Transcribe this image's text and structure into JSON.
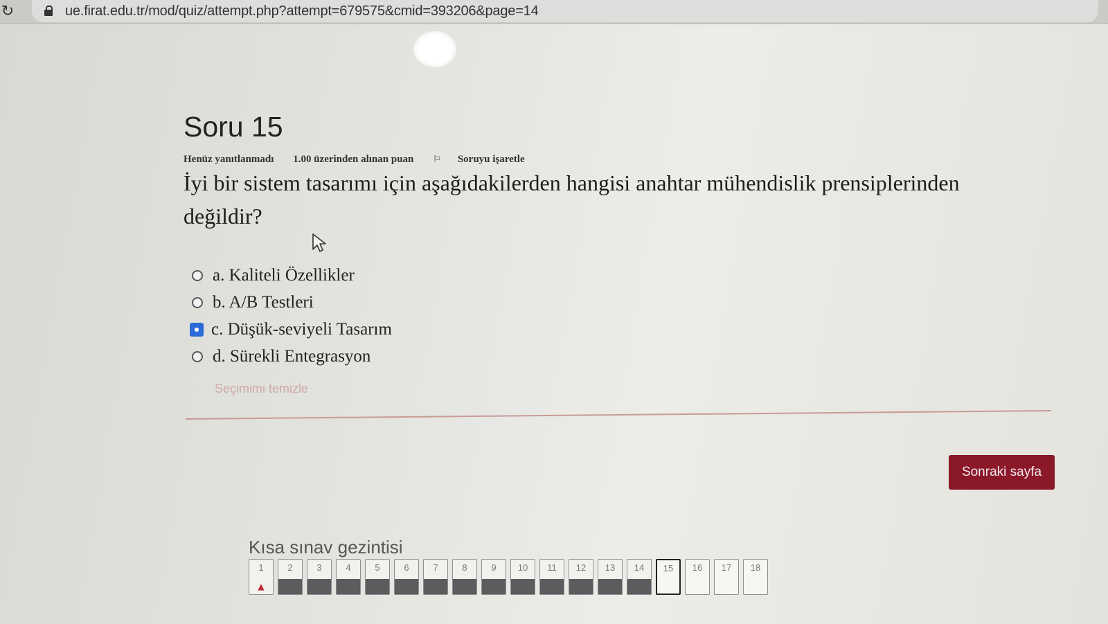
{
  "browser": {
    "url": "ue.firat.edu.tr/mod/quiz/attempt.php?attempt=679575&cmid=393206&page=14"
  },
  "question": {
    "title": "Soru 15",
    "status": "Henüz yanıtlanmadı",
    "points": "1.00 üzerinden alınan puan",
    "flag_label": "Soruyu işaretle",
    "text": "İyi bir sistem tasarımı için aşağıdakilerden hangisi anahtar mühendislik prensiplerinden değildir?",
    "answers": [
      {
        "label": "a. Kaliteli Özellikler",
        "selected": false
      },
      {
        "label": "b. A/B Testleri",
        "selected": false
      },
      {
        "label": "c. Düşük-seviyeli Tasarım",
        "selected": true
      },
      {
        "label": "d. Sürekli Entegrasyon",
        "selected": false
      }
    ],
    "clear_choice": "Seçimimi temizle"
  },
  "next_button": "Sonraki sayfa",
  "navigation": {
    "title": "Kısa sınav gezintisi",
    "items": [
      {
        "label": "1",
        "state": "flagged"
      },
      {
        "label": "2",
        "state": "answered"
      },
      {
        "label": "3",
        "state": "answered"
      },
      {
        "label": "4",
        "state": "answered"
      },
      {
        "label": "5",
        "state": "answered"
      },
      {
        "label": "6",
        "state": "answered"
      },
      {
        "label": "7",
        "state": "answered"
      },
      {
        "label": "8",
        "state": "answered"
      },
      {
        "label": "9",
        "state": "answered"
      },
      {
        "label": "10",
        "state": "answered"
      },
      {
        "label": "11",
        "state": "answered"
      },
      {
        "label": "12",
        "state": "answered"
      },
      {
        "label": "13",
        "state": "answered"
      },
      {
        "label": "14",
        "state": "answered"
      },
      {
        "label": "15",
        "state": "current"
      },
      {
        "label": "16",
        "state": "pending"
      },
      {
        "label": "17",
        "state": "pending"
      },
      {
        "label": "18",
        "state": "pending"
      }
    ]
  },
  "colors": {
    "accent": "#8a1829",
    "selected_radio": "#2b6ad8",
    "flag": "#c0282e"
  }
}
